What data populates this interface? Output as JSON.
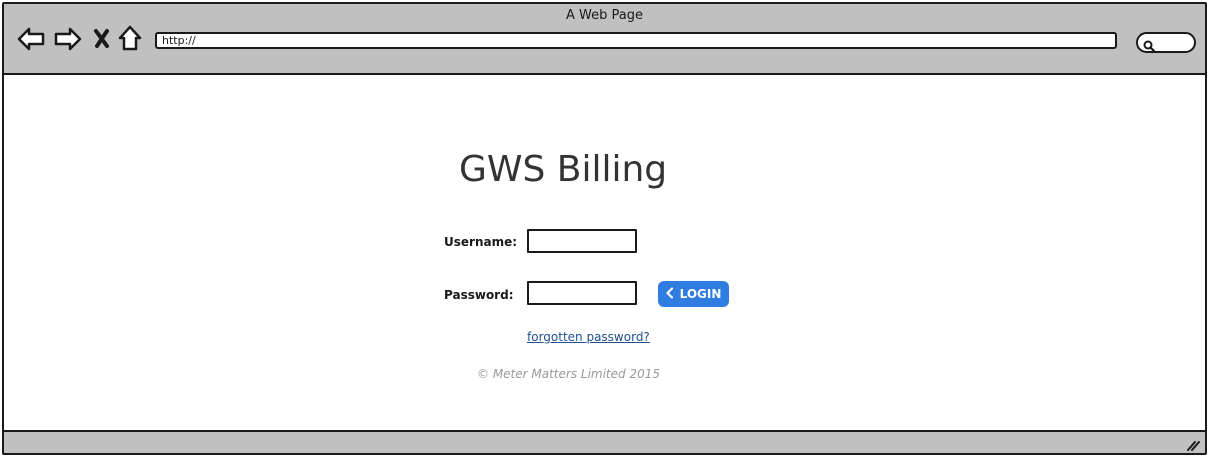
{
  "browser": {
    "window_title": "A Web Page",
    "address": "http://",
    "icons": {
      "back": "back-arrow-icon",
      "forward": "forward-arrow-icon",
      "stop": "close-icon",
      "home": "home-icon",
      "search": "search-icon",
      "resize": "resize-grip-icon"
    }
  },
  "login": {
    "title": "GWS Billing",
    "username_label": "Username:",
    "username_value": "",
    "password_label": "Password:",
    "password_value": "",
    "button_label": "LOGIN",
    "forgot_link": "forgotten password?",
    "copyright": "© Meter Matters Limited 2015"
  },
  "colors": {
    "chrome": "#c0c0c0",
    "button": "#2f7de1",
    "link": "#1f4f8f",
    "copyright": "#999999",
    "title": "#333333"
  }
}
